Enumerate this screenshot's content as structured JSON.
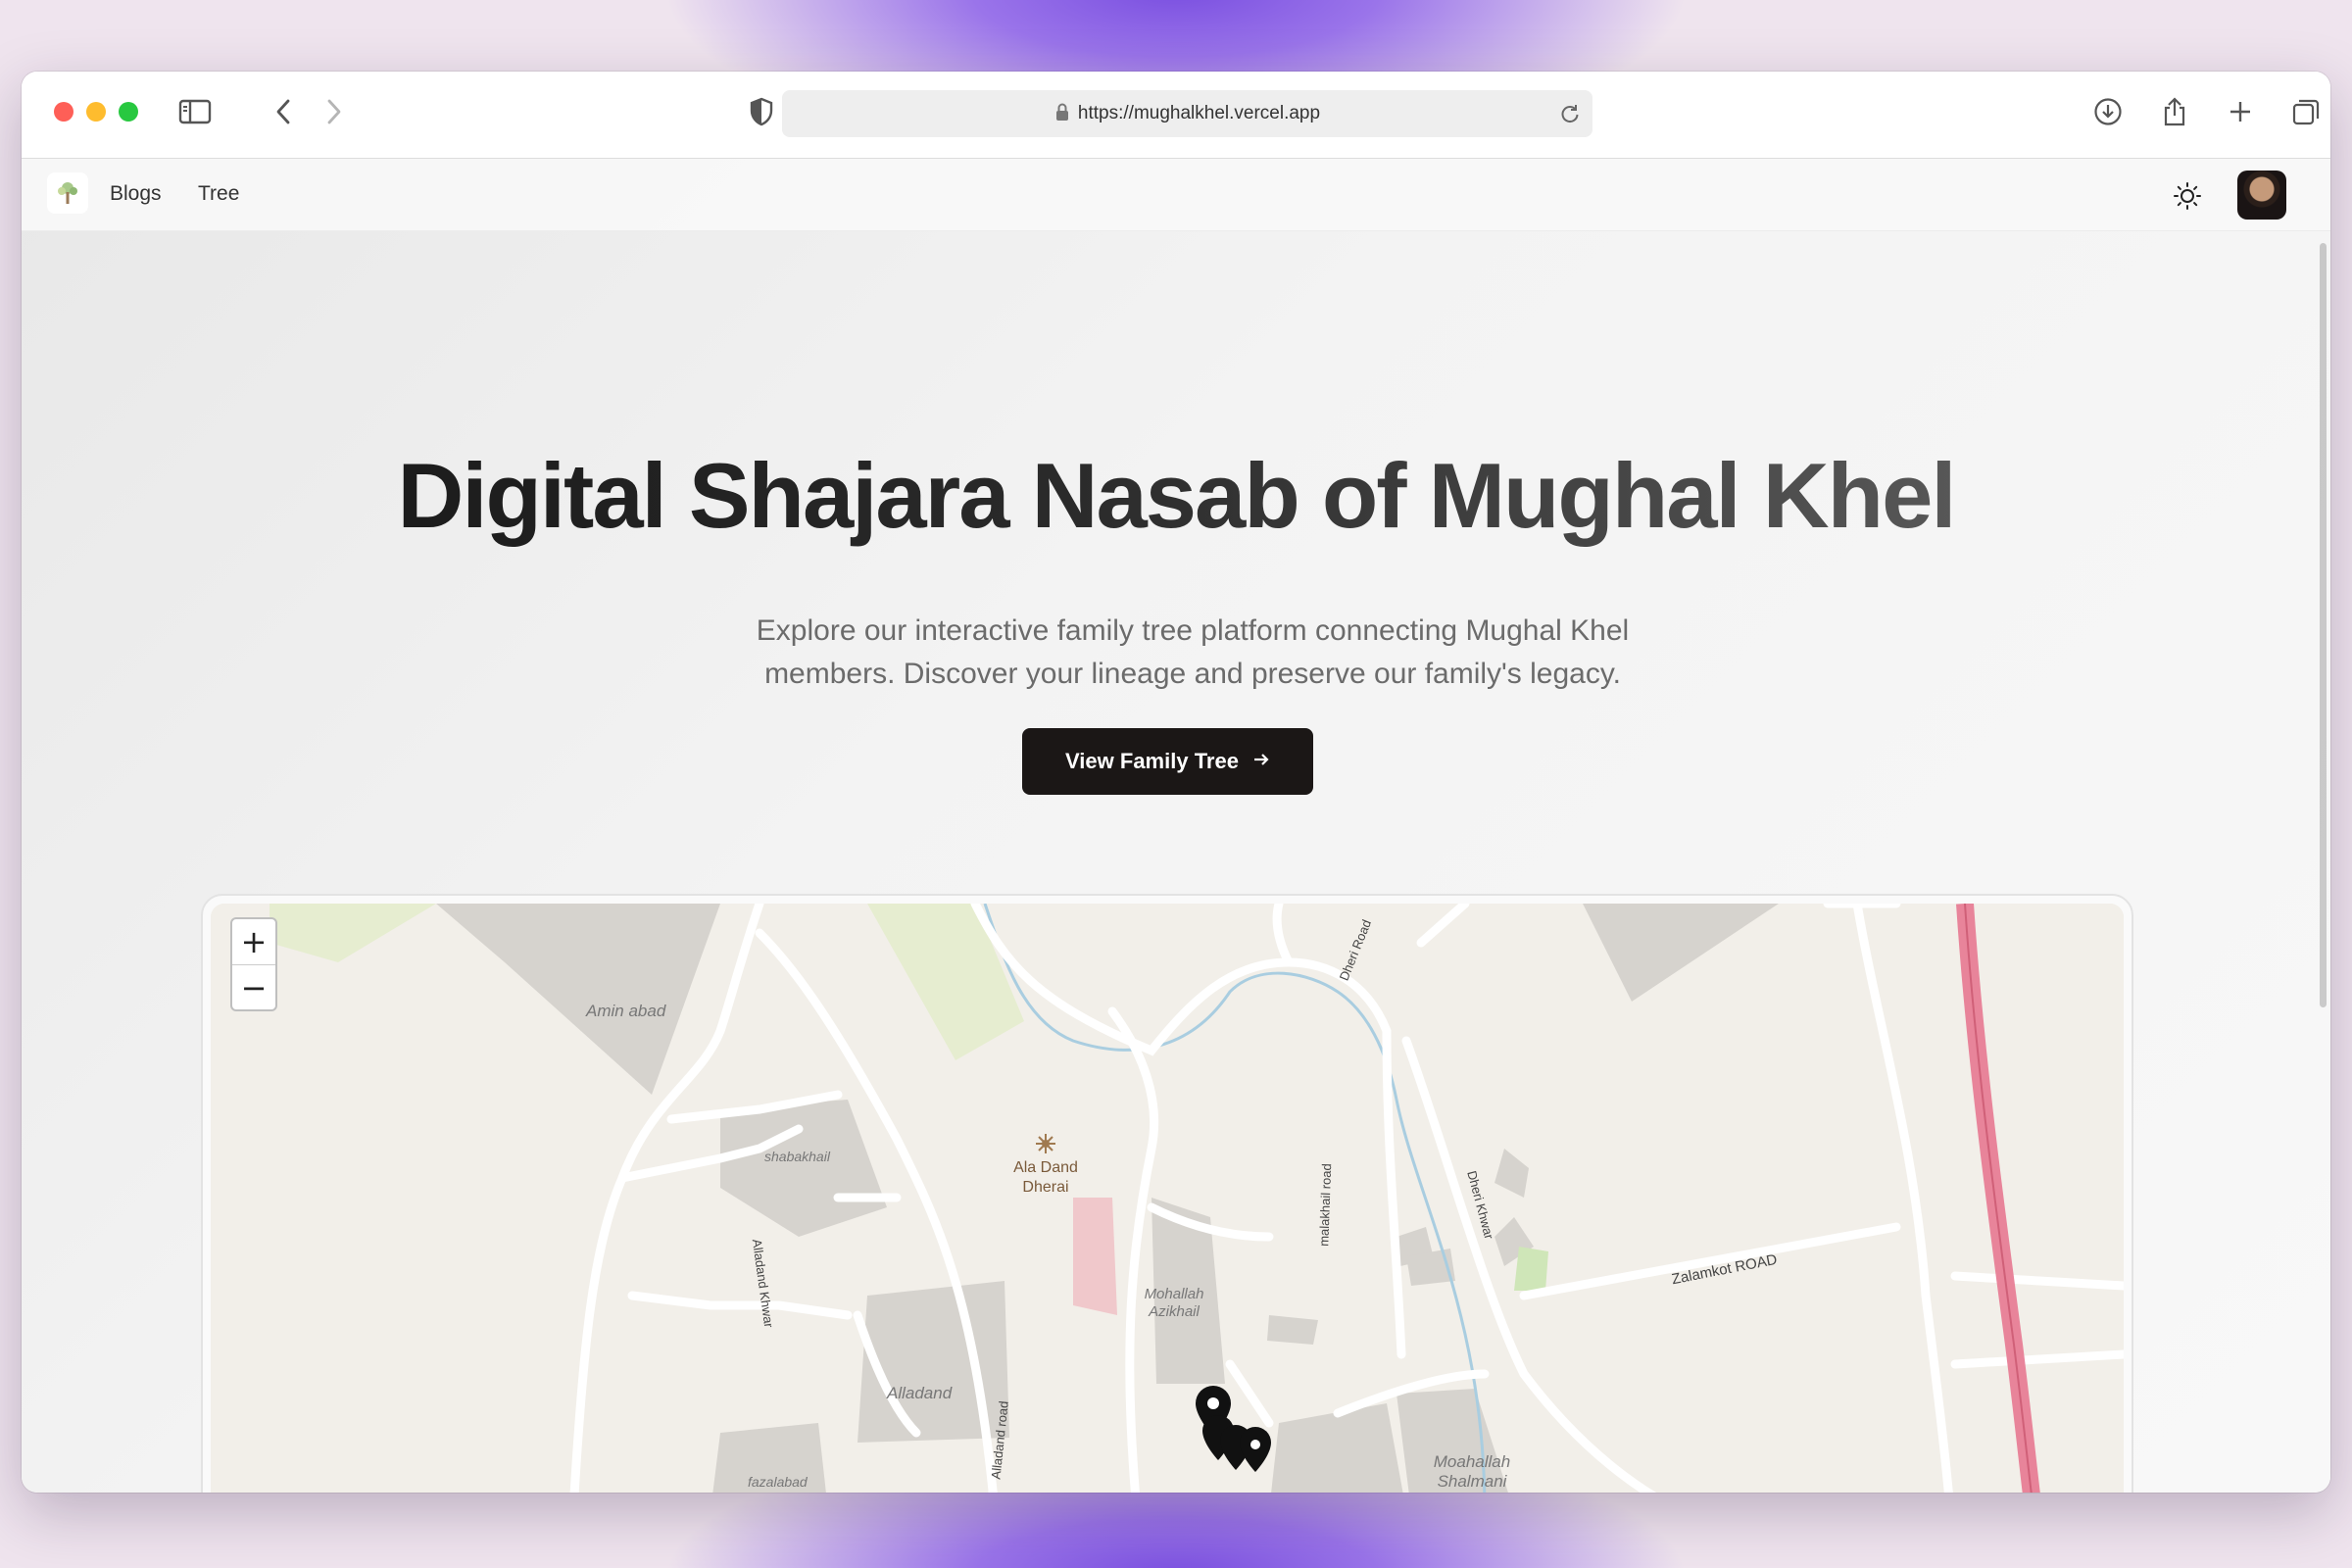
{
  "browser": {
    "url": "https://mughalkhel.vercel.app",
    "icons": [
      "sidebar-icon",
      "back-icon",
      "forward-icon",
      "shield-icon",
      "lock-icon",
      "reload-icon",
      "download-icon",
      "share-icon",
      "new-tab-icon",
      "tabs-overview-icon"
    ]
  },
  "nav": {
    "links": [
      {
        "label": "Blogs"
      },
      {
        "label": "Tree"
      }
    ],
    "icons": [
      "tree-logo-icon",
      "sun-icon"
    ]
  },
  "hero": {
    "title": "Digital Shajara Nasab of Mughal Khel",
    "subtitle": "Explore our interactive family tree platform connecting Mughal Khel members. Discover your lineage and preserve our family's legacy.",
    "cta_label": "View Family Tree",
    "cta_icon": "arrow-right-icon"
  },
  "map": {
    "zoom_in": "+",
    "zoom_out": "−",
    "areas": [
      "Amin abad",
      "shabakhail",
      "Alladand",
      "fazalabad",
      "Mohallah Azikhail",
      "Moahallah Shalmani"
    ],
    "poi": "Ala Dand Dherai",
    "roads": [
      "Dheri Road",
      "malakhail road",
      "Dheri Khwar",
      "Zalamkot ROAD",
      "Alladand Khwar",
      "Alladand road"
    ],
    "marker_icon": "map-pin-icon",
    "colors": {
      "land": "#f2efe9",
      "road": "#ffffff",
      "highway": "#e8849a",
      "river": "#a9cde0",
      "building": "#d6d3ce",
      "park": "#e6edd0"
    }
  }
}
